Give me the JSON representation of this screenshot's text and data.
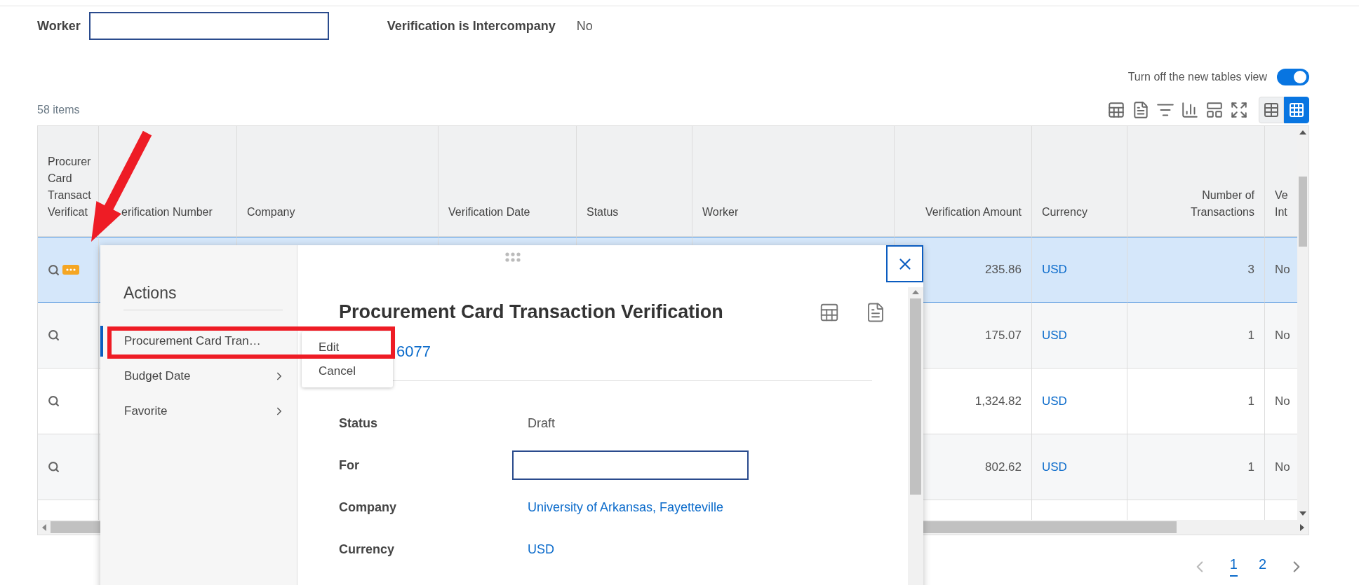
{
  "filters": {
    "worker": {
      "label": "Worker"
    },
    "intercompany": {
      "label": "Verification is Intercompany",
      "value": "No"
    }
  },
  "view_toggle": {
    "label": "Turn off the new tables view",
    "on": true
  },
  "item_count": "58 items",
  "view_modes": [
    {
      "kind": "list",
      "selected": false
    },
    {
      "kind": "grid",
      "selected": true
    }
  ],
  "table": {
    "columns": [
      {
        "label": "Procurer Card Transact Verificat"
      },
      {
        "label": "erification Number"
      },
      {
        "label": "Company"
      },
      {
        "label": "Verification Date"
      },
      {
        "label": "Status"
      },
      {
        "label": "Worker"
      },
      {
        "label": "Verification Amount"
      },
      {
        "label": "Currency"
      },
      {
        "label": "Number of Transactions"
      },
      {
        "label": "Ve Int"
      }
    ],
    "rows": [
      {
        "selected": true,
        "actions": true,
        "amount": "235.86",
        "currency": "USD",
        "transactions": "3",
        "intercompany": "No"
      },
      {
        "selected": false,
        "actions": false,
        "amount": "175.07",
        "currency": "USD",
        "transactions": "1",
        "intercompany": "No"
      },
      {
        "selected": false,
        "actions": false,
        "amount": "1,324.82",
        "currency": "USD",
        "transactions": "1",
        "intercompany": "No"
      },
      {
        "selected": false,
        "actions": false,
        "amount": "802.62",
        "currency": "USD",
        "transactions": "1",
        "intercompany": "No"
      }
    ]
  },
  "popup": {
    "actions_title": "Actions",
    "actions": [
      {
        "label": "Procurement Card Tran…",
        "selected": true,
        "chevron": false
      },
      {
        "label": "Budget Date",
        "selected": false,
        "chevron": true
      },
      {
        "label": "Favorite",
        "selected": false,
        "chevron": true
      }
    ],
    "submenu": [
      "Edit",
      "Cancel"
    ],
    "title": "Procurement Card Transaction Verification",
    "reference": "6077",
    "fields": [
      {
        "label": "Status",
        "kind": "text",
        "value": "Draft"
      },
      {
        "label": "For",
        "kind": "input"
      },
      {
        "label": "Company",
        "kind": "link",
        "value": "University of Arkansas, Fayetteville"
      },
      {
        "label": "Currency",
        "kind": "link",
        "value": "USD"
      }
    ]
  },
  "pagination": {
    "pages": [
      {
        "label": "1",
        "selected": true
      },
      {
        "label": "2",
        "selected": false
      }
    ]
  }
}
